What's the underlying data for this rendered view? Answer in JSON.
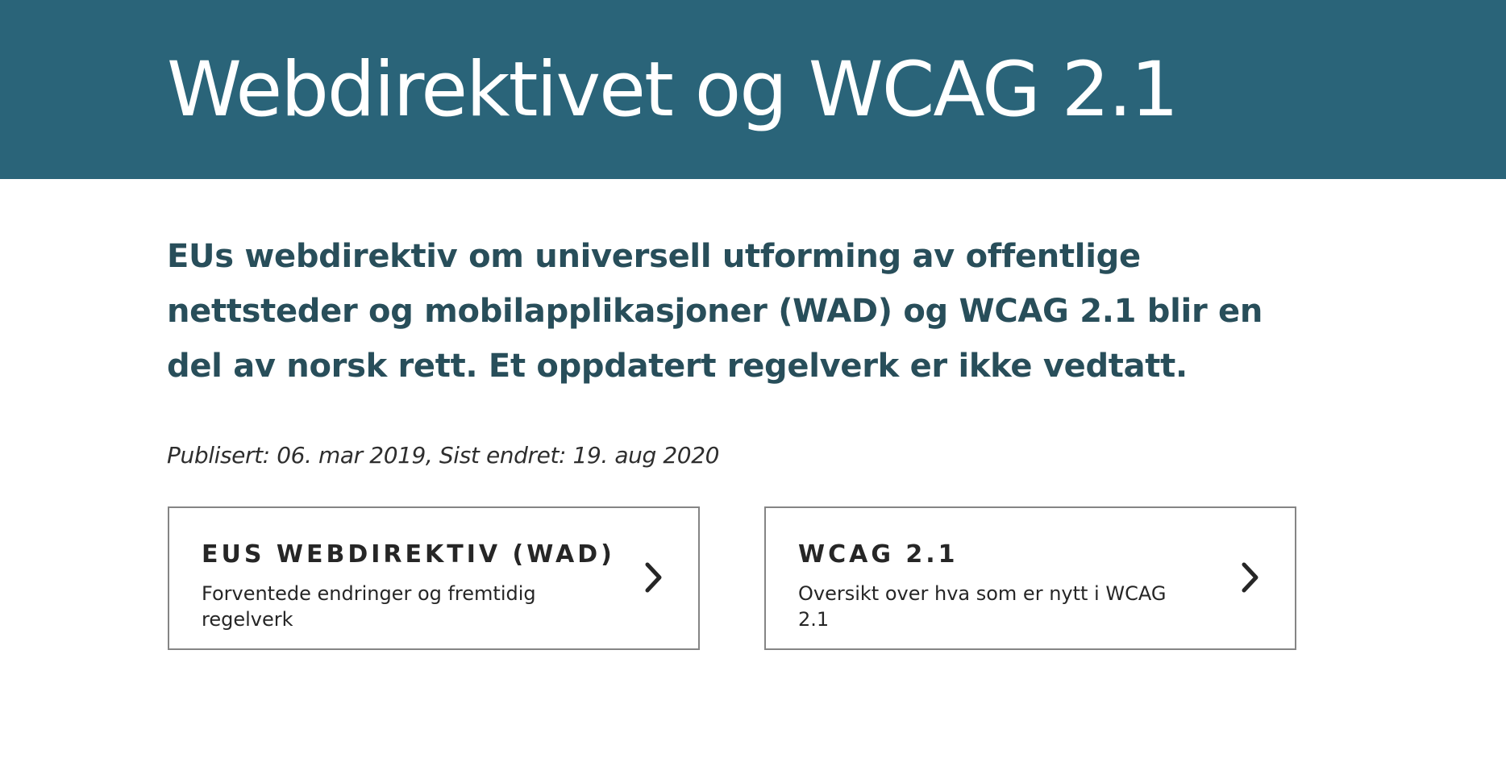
{
  "header": {
    "title": "Webdirektivet og WCAG 2.1",
    "background_color": "#2a6479"
  },
  "lead": {
    "text": "EUs webdirektiv om universell utforming av offentlige nettsteder og mobilapplikasjoner (WAD) og WCAG 2.1 blir en del av norsk rett. Et oppdatert regelverk er ikke vedtatt."
  },
  "meta": {
    "published": "Publisert: 06. mar 2019, Sist endret: 19. aug 2020"
  },
  "cards": [
    {
      "title": "EUS WEBDIREKTIV (WAD)",
      "description": "Forventede endringer og fremtidig regelverk",
      "icon": "chevron-right-icon"
    },
    {
      "title": "WCAG 2.1",
      "description": "Oversikt over hva som er nytt i WCAG 2.1",
      "icon": "chevron-right-icon"
    }
  ]
}
